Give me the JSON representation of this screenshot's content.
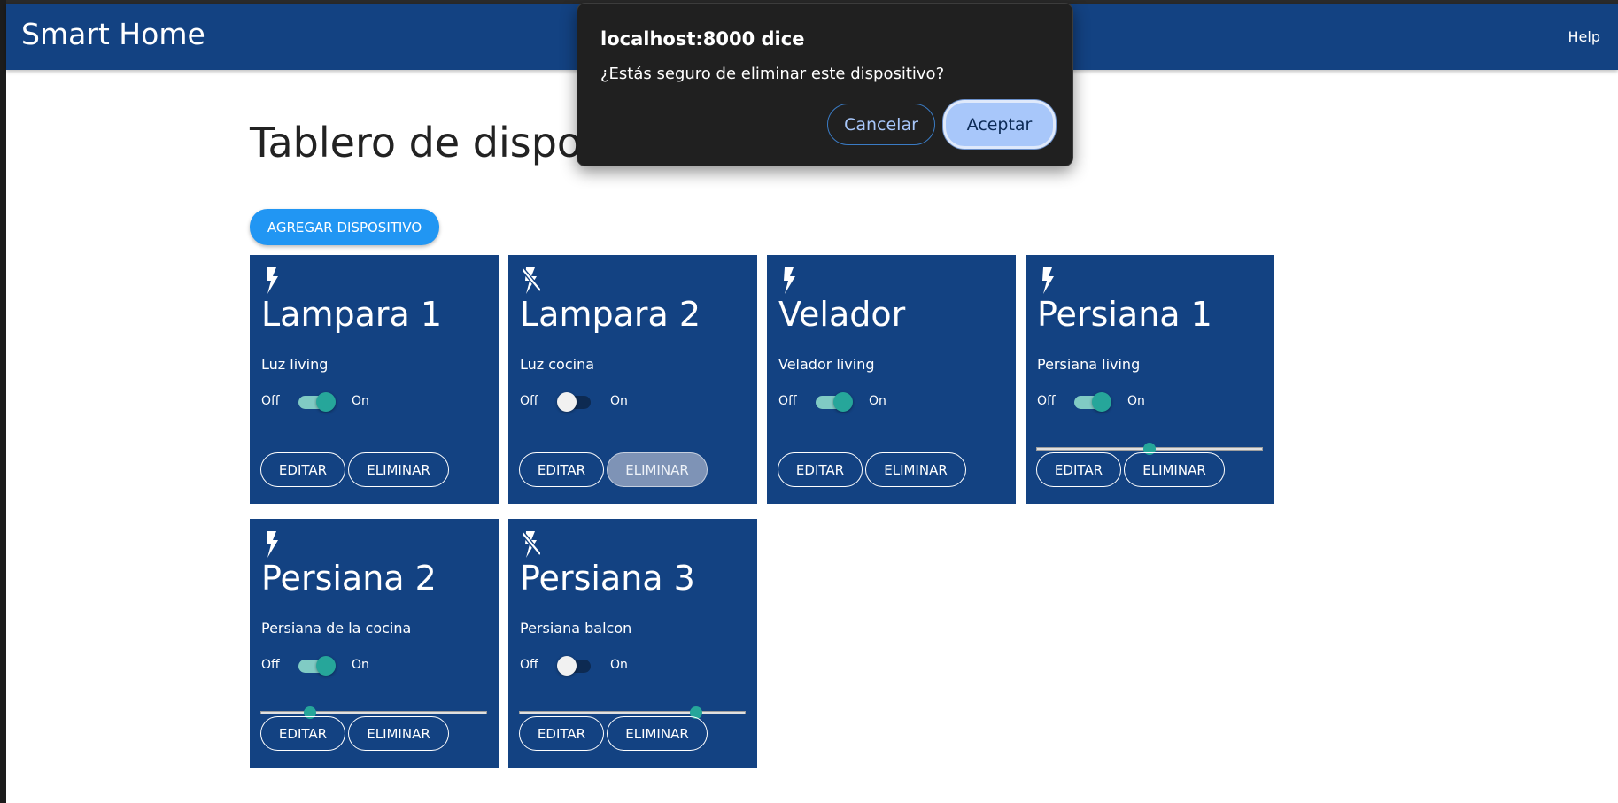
{
  "navbar": {
    "brand": "Smart Home",
    "help": "Help"
  },
  "page": {
    "title": "Tablero de dispositivos",
    "add_button": "AGREGAR DISPOSITIVO"
  },
  "labels": {
    "off": "Off",
    "on": "On",
    "edit": "EDITAR",
    "delete": "ELIMINAR"
  },
  "devices": [
    {
      "name": "Lampara 1",
      "description": "Luz living",
      "state": "on",
      "icon": "bolt-icon"
    },
    {
      "name": "Lampara 2",
      "description": "Luz cocina",
      "state": "off",
      "icon": "bolt-off-icon"
    },
    {
      "name": "Velador",
      "description": "Velador living",
      "state": "on",
      "icon": "bolt-icon"
    },
    {
      "name": "Persiana 1",
      "description": "Persiana living",
      "state": "on",
      "icon": "bolt-icon",
      "level_percent": 50
    },
    {
      "name": "Persiana 2",
      "description": "Persiana de la cocina",
      "state": "on",
      "icon": "bolt-icon",
      "level_percent": 22
    },
    {
      "name": "Persiana 3",
      "description": "Persiana balcon",
      "state": "off",
      "icon": "bolt-off-icon",
      "level_percent": 78
    }
  ],
  "dialog": {
    "origin": "localhost:8000 dice",
    "message": "¿Estás seguro de eliminar este dispositivo?",
    "cancel": "Cancelar",
    "accept": "Aceptar"
  },
  "colors": {
    "navbar": "#134282",
    "card": "#134282",
    "accent": "#2196f3",
    "toggle_on": "#26a69a",
    "dialog_bg": "#202020",
    "dialog_accept": "#a8c7fa"
  }
}
